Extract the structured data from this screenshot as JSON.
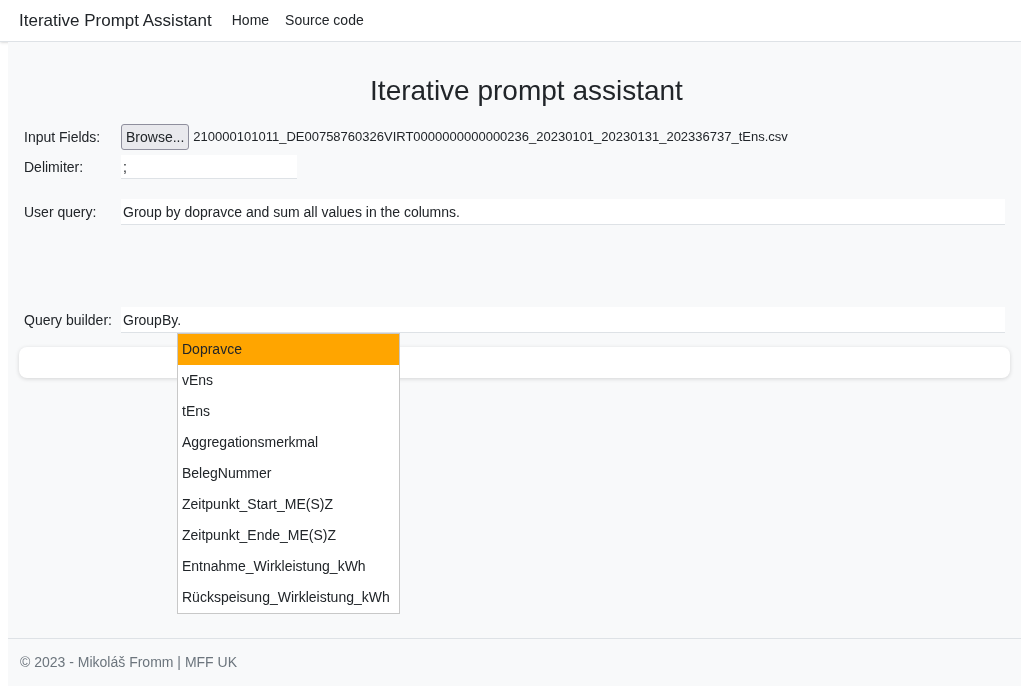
{
  "navbar": {
    "brand": "Iterative Prompt Assistant",
    "links": [
      "Home",
      "Source code"
    ]
  },
  "heading": "Iterative prompt assistant",
  "input_fields": {
    "label": "Input Fields:",
    "button": "Browse...",
    "file_name": "210000101011_DE00758760326VIRT0000000000000236_20230101_20230131_202336737_tEns.csv"
  },
  "delimiter": {
    "label": "Delimiter:",
    "value": ";"
  },
  "user_query": {
    "label": "User query:",
    "value": "Group by dopravce and sum all values in the columns."
  },
  "query_builder": {
    "label": "Query builder:",
    "value": "GroupBy.",
    "suggestions": [
      {
        "label": "Dopravce",
        "selected": true
      },
      {
        "label": "vEns",
        "selected": false
      },
      {
        "label": "tEns",
        "selected": false
      },
      {
        "label": "Aggregationsmerkmal",
        "selected": false
      },
      {
        "label": "BelegNummer",
        "selected": false
      },
      {
        "label": "Zeitpunkt_Start_ME(S)Z",
        "selected": false
      },
      {
        "label": "Zeitpunkt_Ende_ME(S)Z",
        "selected": false
      },
      {
        "label": "Entnahme_Wirkleistung_kWh",
        "selected": false
      },
      {
        "label": "Rückspeisung_Wirkleistung_kWh",
        "selected": false
      }
    ]
  },
  "footer": "© 2023 - Mikoláš Fromm | MFF UK"
}
